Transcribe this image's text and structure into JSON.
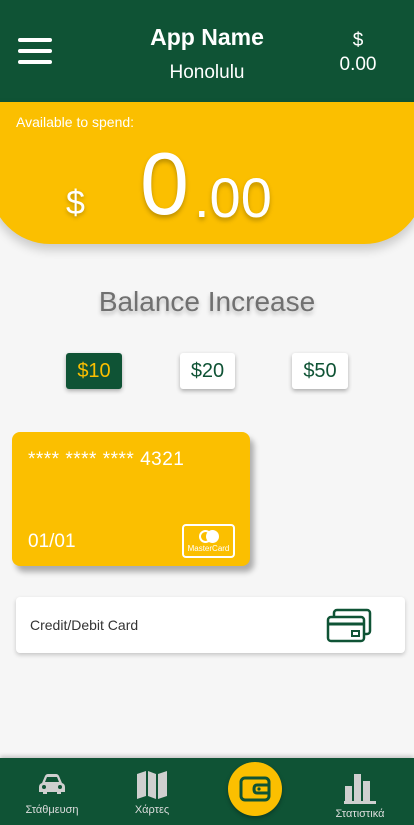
{
  "header": {
    "app_name": "App Name",
    "city": "Honolulu",
    "balance_symbol": "$",
    "balance_value": "0.00"
  },
  "balance": {
    "label": "Available to spend:",
    "currency": "$",
    "integer": "0",
    "decimal": ".00"
  },
  "increase": {
    "title": "Balance Increase",
    "options": [
      "$10",
      "$20",
      "$50"
    ],
    "selected": "$10"
  },
  "card": {
    "number": "**** **** **** 4321",
    "expiry": "01/01",
    "brand": "MasterCard"
  },
  "payment_method": {
    "label": "Credit/Debit Card",
    "icon": "credit-cards-icon"
  },
  "nav": {
    "parking": "Στάθμευση",
    "maps": "Χάρτες",
    "wallet_icon": "wallet-icon",
    "stats": "Στατιστικά"
  },
  "colors": {
    "primary": "#0f5335",
    "accent": "#fbbf00",
    "background": "#f6f6f6"
  }
}
